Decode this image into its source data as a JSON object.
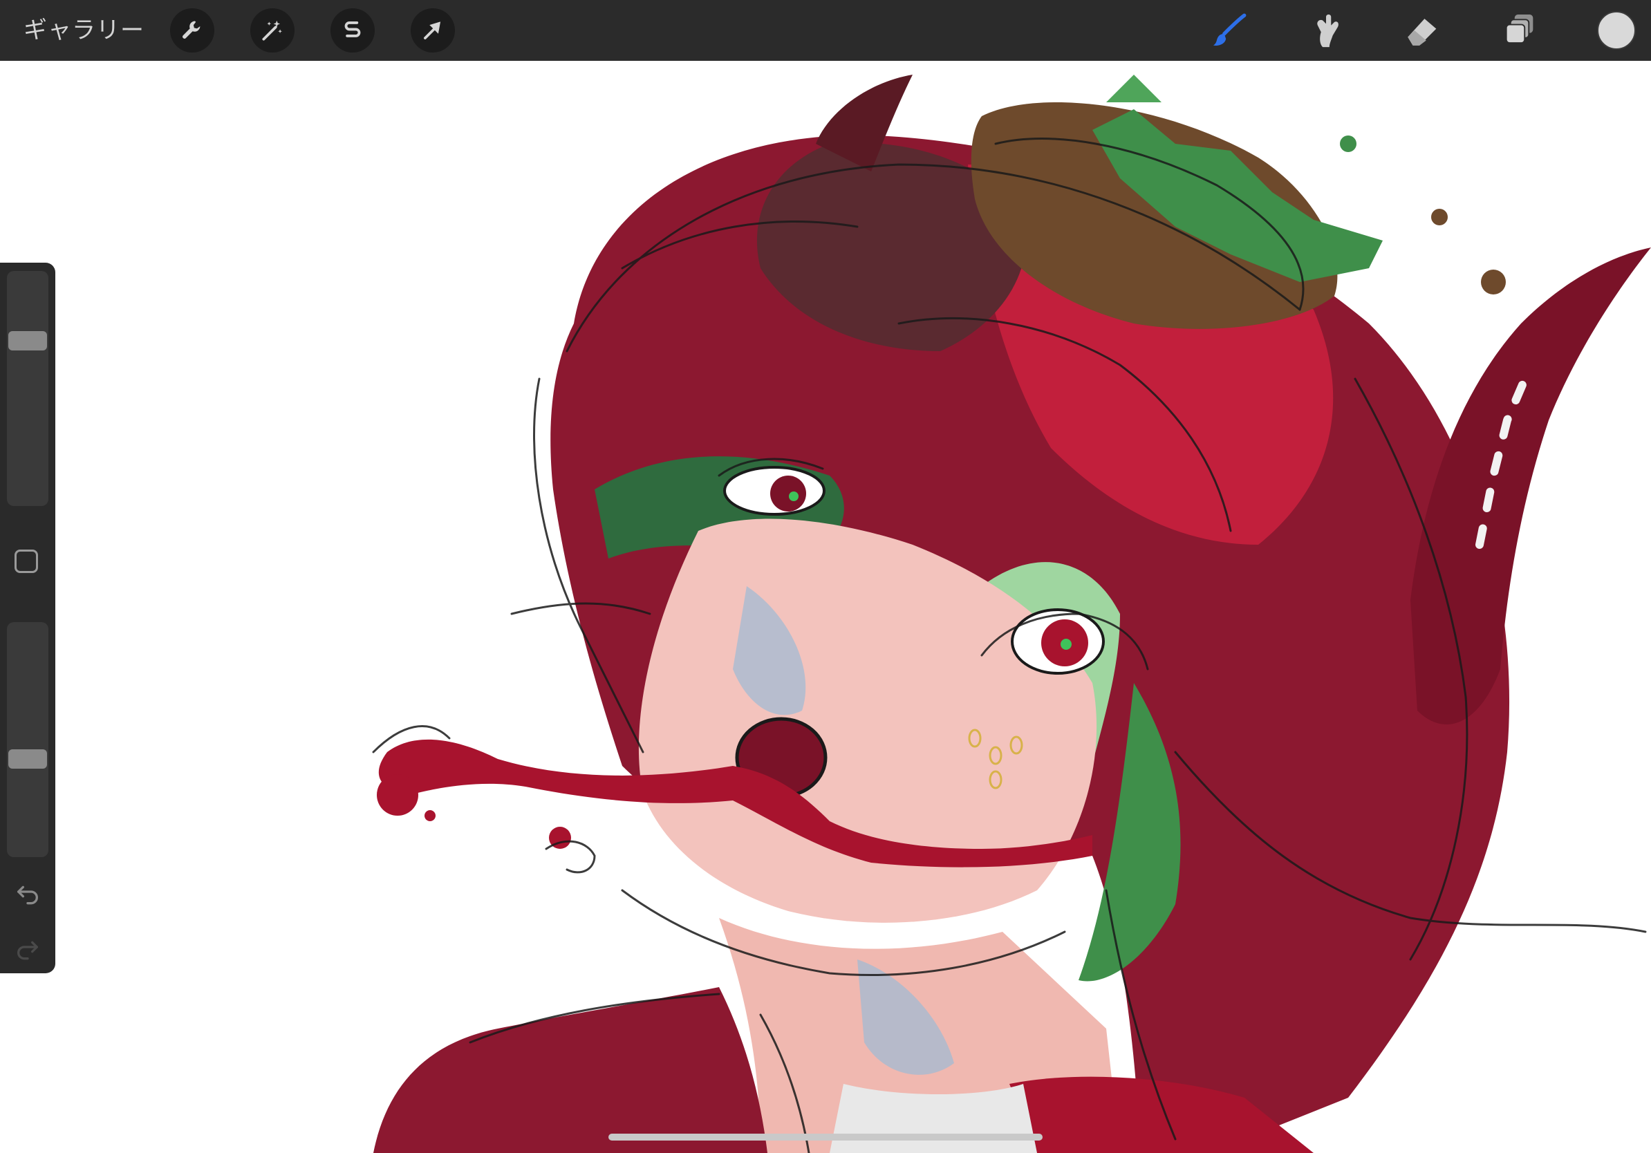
{
  "toolbar": {
    "gallery_label": "ギャラリー",
    "left_tools": [
      {
        "name": "wrench-icon",
        "label": "actions"
      },
      {
        "name": "magic-wand-icon",
        "label": "adjustments"
      },
      {
        "name": "selection-s-icon",
        "label": "selection"
      },
      {
        "name": "arrow-cursor-icon",
        "label": "transform"
      }
    ],
    "right_tools": [
      {
        "name": "brush-icon",
        "label": "paint",
        "active": true
      },
      {
        "name": "smudge-icon",
        "label": "smudge"
      },
      {
        "name": "eraser-icon",
        "label": "erase"
      },
      {
        "name": "layers-icon",
        "label": "layers"
      }
    ],
    "current_color": "#d9d9d9",
    "active_tool_color": "#2d6fe8"
  },
  "sidebar": {
    "brush_size_level": 0.28,
    "opacity_level": 0.59,
    "modify_icon": "square-icon",
    "undo_icon": "undo-arrow-icon",
    "redo_icon": "redo-arrow-icon"
  },
  "canvas": {
    "background": "#ffffff",
    "palette": {
      "crimson": "#a8132e",
      "deep_red": "#7a1228",
      "maroon": "#5a1a24",
      "green": "#3f8f4a",
      "pale_green": "#9fd6a0",
      "skin": "#f3c3bd",
      "brown": "#6e4a2c",
      "line": "#1a1a1a",
      "blue_shadow": "#9dbbd6"
    }
  }
}
